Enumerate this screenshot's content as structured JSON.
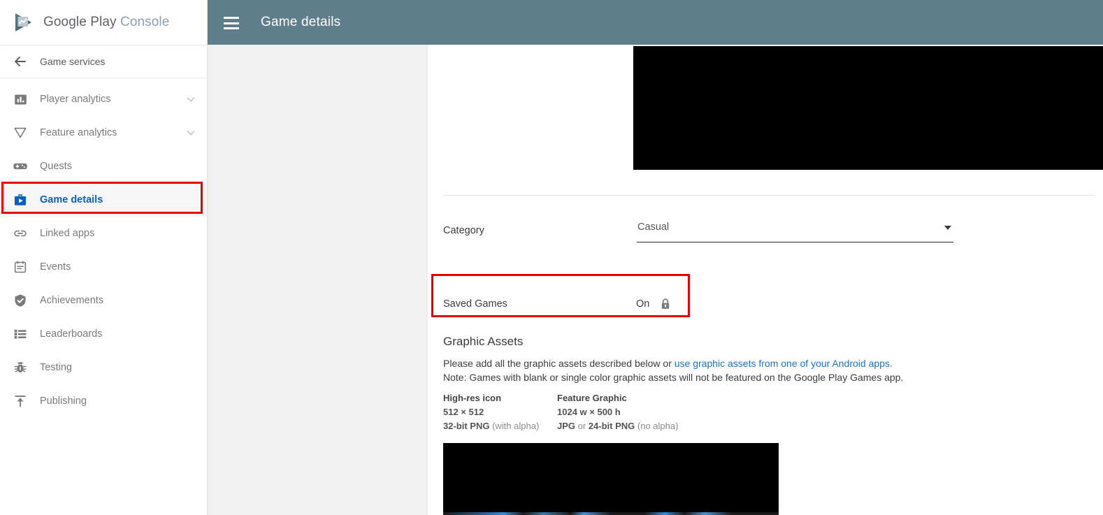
{
  "brand": {
    "logo_icon": "google-play-logo",
    "word_primary": "Google Play",
    "word_secondary": "Console"
  },
  "sidebar": {
    "back": {
      "icon": "arrow-back-icon",
      "label": "Game services"
    },
    "items": [
      {
        "icon": "bar-chart-icon",
        "label": "Player analytics",
        "expandable": true,
        "active": false
      },
      {
        "icon": "funnel-icon",
        "label": "Feature analytics",
        "expandable": true,
        "active": false
      },
      {
        "icon": "gamepad-icon",
        "label": "Quests",
        "expandable": false,
        "active": false
      },
      {
        "icon": "briefcase-play-icon",
        "label": "Game details",
        "expandable": false,
        "active": true
      },
      {
        "icon": "link-icon",
        "label": "Linked apps",
        "expandable": false,
        "active": false
      },
      {
        "icon": "calendar-icon",
        "label": "Events",
        "expandable": false,
        "active": false
      },
      {
        "icon": "shield-check-icon",
        "label": "Achievements",
        "expandable": false,
        "active": false
      },
      {
        "icon": "list-icon",
        "label": "Leaderboards",
        "expandable": false,
        "active": false
      },
      {
        "icon": "bug-icon",
        "label": "Testing",
        "expandable": false,
        "active": false
      },
      {
        "icon": "upload-icon",
        "label": "Publishing",
        "expandable": false,
        "active": false
      }
    ]
  },
  "header": {
    "menu_icon": "hamburger-menu-icon",
    "title": "Game details",
    "background": "#607d8b"
  },
  "main": {
    "banner_image": "redacted-black-image",
    "category": {
      "label": "Category",
      "selected": "Casual",
      "caret_icon": "chevron-down-icon"
    },
    "saved_games": {
      "label": "Saved Games",
      "value": "On",
      "lock_icon": "lock-closed-icon"
    },
    "graphic_assets": {
      "title": "Graphic Assets",
      "para1_before_link": "Please add all the graphic assets described below or ",
      "para1_link": "use graphic assets from one of your Android apps.",
      "para2": "Note: Games with blank or single color graphic assets will not be featured on the Google Play Games app.",
      "specs": [
        {
          "title": "High-res icon",
          "size": "512 × 512",
          "format_bold": "32-bit PNG",
          "format_rest": " (with alpha)",
          "format_prefix": ""
        },
        {
          "title": "Feature Graphic",
          "size": "1024 w × 500 h",
          "format_bold": "24-bit PNG",
          "format_rest": " (no alpha)",
          "format_prefix_bold": "JPG",
          "format_prefix": " or "
        }
      ],
      "asset_image": "redacted-black-image"
    }
  },
  "highlights": {
    "color": "#ec0000",
    "boxes": [
      "sidebar-item-game-details",
      "saved-games-row"
    ]
  }
}
